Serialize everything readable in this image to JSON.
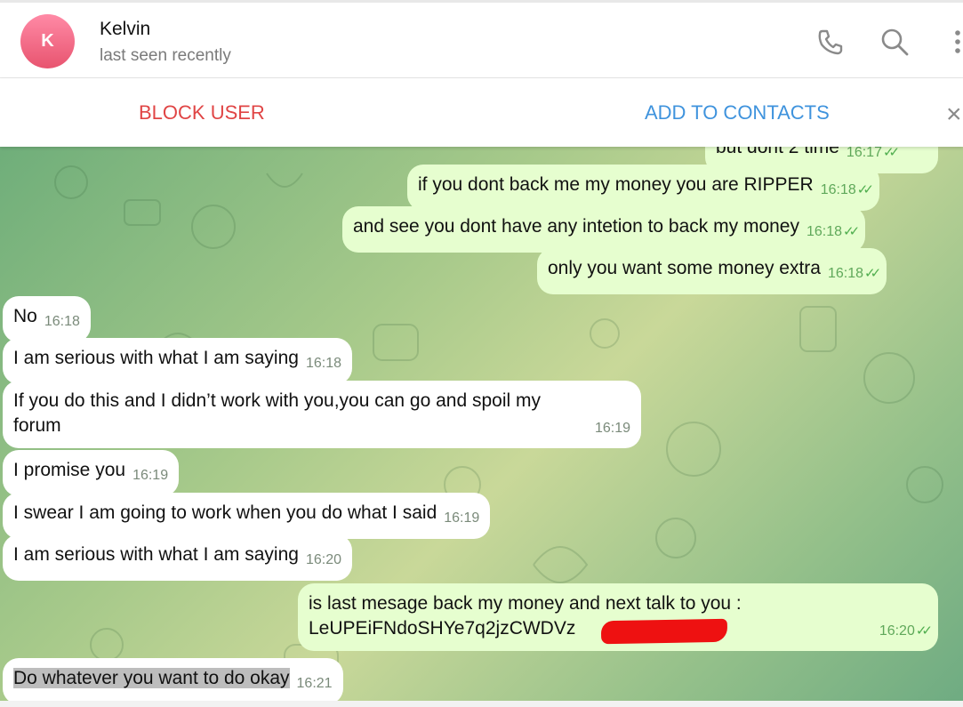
{
  "header": {
    "avatar_letter": "K",
    "name": "Kelvin",
    "status": "last seen recently"
  },
  "action_bar": {
    "block_label": "BLOCK USER",
    "add_label": "ADD TO CONTACTS",
    "close_glyph": "×"
  },
  "colors": {
    "block": "#e04545",
    "add": "#3f93dd",
    "outgoing_bubble": "#e6fecf",
    "incoming_bubble": "#ffffff"
  },
  "messages": [
    {
      "dir": "out",
      "text": "but dont 2 time",
      "time": "16:17"
    },
    {
      "dir": "out",
      "text": "if you dont back me my money you are RIPPER",
      "time": "16:18"
    },
    {
      "dir": "out",
      "text": "and see you dont have any intetion to back my money",
      "time": "16:18"
    },
    {
      "dir": "out",
      "text": "only you want some money extra",
      "time": "16:18"
    },
    {
      "dir": "in",
      "text": "No",
      "time": "16:18"
    },
    {
      "dir": "in",
      "text": "I am serious with what I am saying",
      "time": "16:18"
    },
    {
      "dir": "in",
      "text": "If you do this and I didn’t work with you,you can go and spoil my",
      "text2": "forum",
      "time": "16:19"
    },
    {
      "dir": "in",
      "text": "I promise you",
      "time": "16:19"
    },
    {
      "dir": "in",
      "text": "I swear I am going to work when you do what I said",
      "time": "16:19"
    },
    {
      "dir": "in",
      "text": "I am serious with what I am saying",
      "time": "16:20"
    },
    {
      "dir": "out",
      "text": "is last mesage back my money and next talk to you :",
      "text2": "LeUPEiFNdoSHYe7q2jzCWDVz",
      "time": "16:20"
    },
    {
      "dir": "in",
      "text": "Do whatever you want to do okay",
      "time": "16:21"
    }
  ],
  "icons": [
    "phone-icon",
    "search-icon",
    "more-vertical-icon",
    "close-icon",
    "read-ticks-icon"
  ]
}
